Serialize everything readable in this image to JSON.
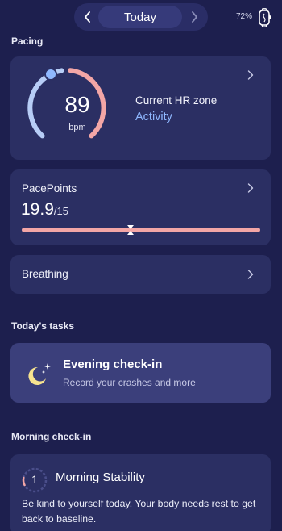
{
  "header": {
    "date_label": "Today",
    "battery": "72%"
  },
  "pacing": {
    "section_label": "Pacing",
    "heart_rate": {
      "value": "89",
      "unit": "bpm",
      "zone_title": "Current HR zone",
      "zone_value": "Activity"
    },
    "pace_points": {
      "title": "PacePoints",
      "value": "19.9",
      "max": "/15",
      "fill_fraction": 1.0,
      "threshold_fraction": 0.455
    },
    "breathing": {
      "label": "Breathing"
    }
  },
  "tasks": {
    "section_label": "Today's tasks",
    "items": [
      {
        "title": "Evening check-in",
        "subtitle": "Record your crashes and more",
        "icon": "moon-stars-icon"
      }
    ]
  },
  "morning": {
    "section_label": "Morning check-in",
    "stability": {
      "score": "1",
      "title": "Morning Stability",
      "description": "Be kind to yourself today. Your body needs rest to get back to baseline."
    }
  },
  "colors": {
    "background": "#1d1f4e",
    "card": "#2b2f63",
    "accent_blue": "#8fb8ff",
    "accent_pink": "#f3a6a6"
  }
}
